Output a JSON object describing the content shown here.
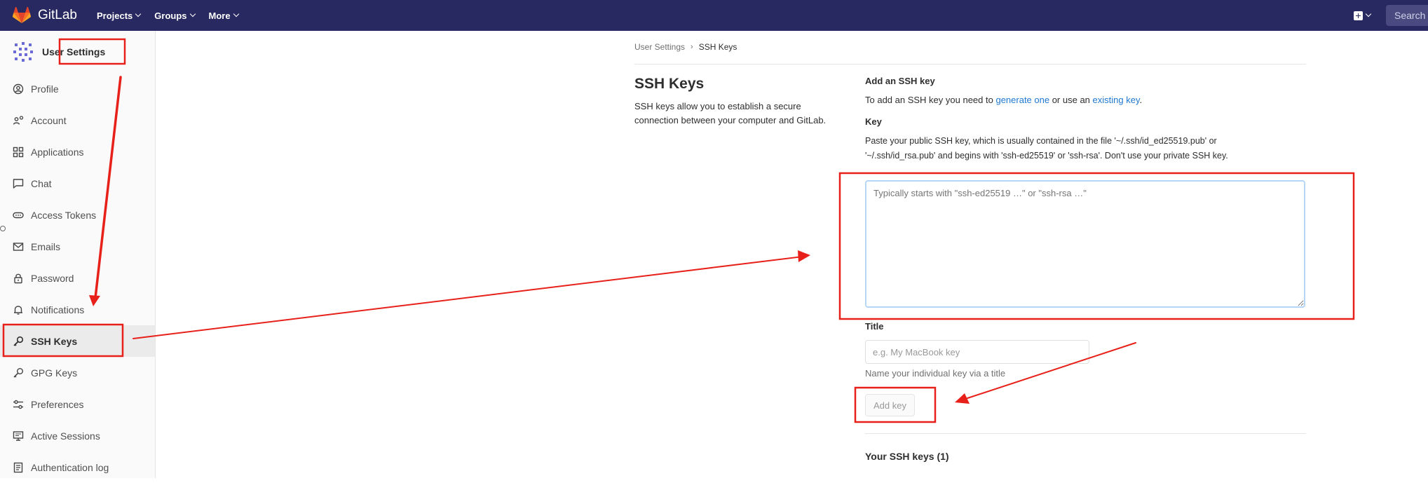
{
  "navbar": {
    "brand": "GitLab",
    "menu": [
      {
        "id": "projects",
        "label": "Projects"
      },
      {
        "id": "groups",
        "label": "Groups"
      },
      {
        "id": "more",
        "label": "More"
      }
    ],
    "search_placeholder": "Search o"
  },
  "sidebar": {
    "title_prefix": "User",
    "title_highlight": "Settings",
    "items": [
      {
        "id": "profile",
        "label": "Profile",
        "icon": "profile-icon"
      },
      {
        "id": "account",
        "label": "Account",
        "icon": "account-icon"
      },
      {
        "id": "applications",
        "label": "Applications",
        "icon": "applications-icon"
      },
      {
        "id": "chat",
        "label": "Chat",
        "icon": "chat-icon"
      },
      {
        "id": "access-tokens",
        "label": "Access Tokens",
        "icon": "token-icon"
      },
      {
        "id": "emails",
        "label": "Emails",
        "icon": "mail-icon"
      },
      {
        "id": "password",
        "label": "Password",
        "icon": "lock-icon"
      },
      {
        "id": "notifications",
        "label": "Notifications",
        "icon": "bell-icon"
      },
      {
        "id": "ssh-keys",
        "label": "SSH Keys",
        "icon": "key-icon",
        "active": true
      },
      {
        "id": "gpg-keys",
        "label": "GPG Keys",
        "icon": "key-icon"
      },
      {
        "id": "preferences",
        "label": "Preferences",
        "icon": "preferences-icon"
      },
      {
        "id": "active-sessions",
        "label": "Active Sessions",
        "icon": "monitor-icon"
      },
      {
        "id": "authentication-log",
        "label": "Authentication log",
        "icon": "log-icon"
      }
    ]
  },
  "breadcrumb": {
    "parent": "User Settings",
    "separator": "›",
    "current": "SSH Keys"
  },
  "page": {
    "title": "SSH Keys",
    "description": "SSH keys allow you to establish a secure connection between your computer and GitLab."
  },
  "form": {
    "section_title": "Add an SSH key",
    "intro_before": "To add an SSH key you need to ",
    "intro_link1": "generate one",
    "intro_middle": " or use an ",
    "intro_link2": "existing key",
    "intro_after": ".",
    "key_label": "Key",
    "key_help_line1": "Paste your public SSH key, which is usually contained in the file '~/.ssh/id_ed25519.pub' or",
    "key_help_line2": "'~/.ssh/id_rsa.pub' and begins with 'ssh-ed25519' or 'ssh-rsa'. Don't use your private SSH key.",
    "key_placeholder": "Typically starts with \"ssh-ed25519 …\" or \"ssh-rsa …\"",
    "key_value": "",
    "title_label": "Title",
    "title_placeholder": "e.g. My MacBook key",
    "title_value": "",
    "title_help": "Name your individual key via a title",
    "submit_label": "Add key"
  },
  "your_keys_title": "Your SSH keys (1)",
  "colors": {
    "navbar": "#292961",
    "link": "#1f78d1",
    "annotation": "#e8201a",
    "focus": "#b5d6f5"
  }
}
